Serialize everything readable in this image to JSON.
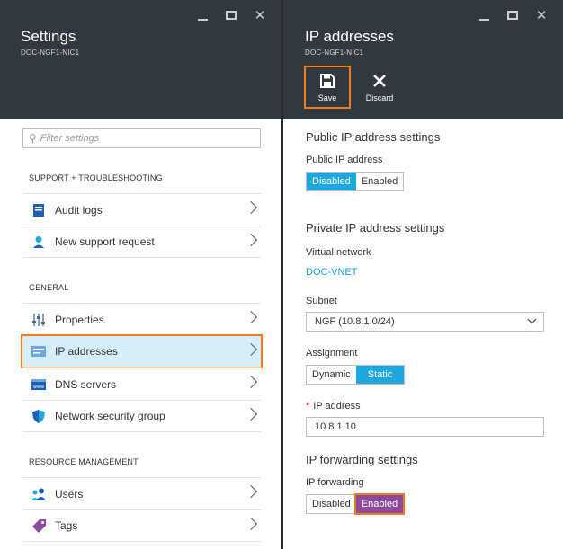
{
  "settings_blade": {
    "title": "Settings",
    "subtitle": "DOC-NGF1-NIC1",
    "filter_placeholder": "Filter settings",
    "sections": [
      {
        "label": "SUPPORT + TROUBLESHOOTING",
        "items": [
          {
            "label": "Audit logs",
            "icon": "audit-log-icon"
          },
          {
            "label": "New support request",
            "icon": "support-person-icon"
          }
        ]
      },
      {
        "label": "GENERAL",
        "items": [
          {
            "label": "Properties",
            "icon": "properties-sliders-icon"
          },
          {
            "label": "IP addresses",
            "icon": "ip-address-icon",
            "selected": true
          },
          {
            "label": "DNS servers",
            "icon": "dns-server-icon"
          },
          {
            "label": "Network security group",
            "icon": "shield-icon"
          }
        ]
      },
      {
        "label": "RESOURCE MANAGEMENT",
        "items": [
          {
            "label": "Users",
            "icon": "users-icon"
          },
          {
            "label": "Tags",
            "icon": "tag-icon"
          }
        ]
      }
    ]
  },
  "ip_blade": {
    "title": "IP addresses",
    "subtitle": "DOC-NGF1-NIC1",
    "commands": {
      "save": "Save",
      "discard": "Discard"
    },
    "public": {
      "heading": "Public IP address settings",
      "label": "Public IP address",
      "options": [
        "Disabled",
        "Enabled"
      ],
      "selected": "Disabled"
    },
    "private": {
      "heading": "Private IP address settings",
      "vnet_label": "Virtual network",
      "vnet_value": "DOC-VNET",
      "subnet_label": "Subnet",
      "subnet_value": "NGF (10.8.1.0/24)",
      "assignment_label": "Assignment",
      "assignment_options": [
        "Dynamic",
        "Static"
      ],
      "assignment_selected": "Static",
      "required_marker": "*",
      "ip_label": "IP address",
      "ip_value": "10.8.1.10"
    },
    "forwarding": {
      "heading": "IP forwarding settings",
      "label": "IP forwarding",
      "options": [
        "Disabled",
        "Enabled"
      ],
      "selected": "Enabled"
    }
  },
  "colors": {
    "header_bg": "#32383f",
    "accent_blue": "#1fa8dd",
    "accent_purple": "#8b4a9c",
    "highlight_orange": "#f07c20",
    "link": "#1a9ad6"
  }
}
